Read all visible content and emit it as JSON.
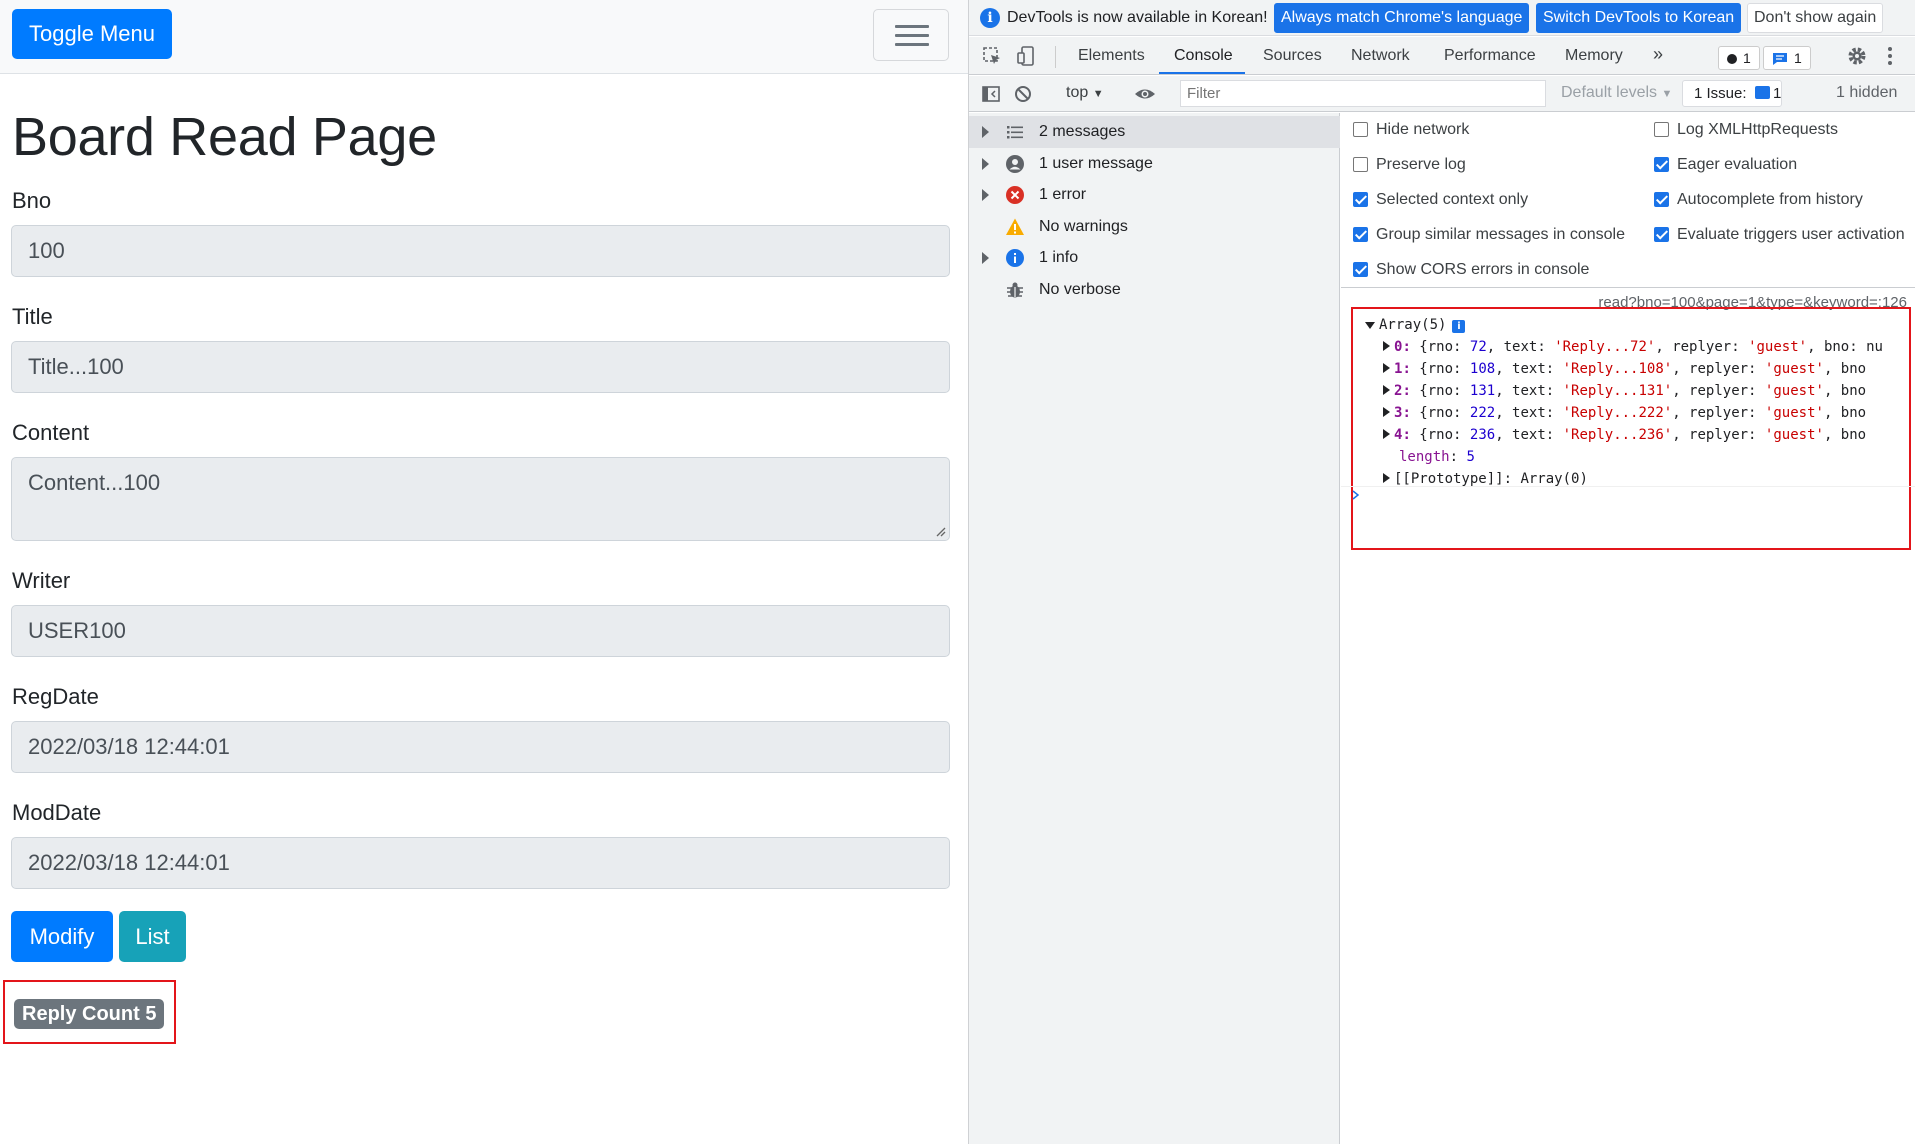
{
  "page": {
    "navbar": {
      "toggle_label": "Toggle Menu"
    },
    "title": "Board Read Page",
    "fields": {
      "bno": {
        "label": "Bno",
        "value": "100"
      },
      "title": {
        "label": "Title",
        "value": "Title...100"
      },
      "content": {
        "label": "Content",
        "value": "Content...100"
      },
      "writer": {
        "label": "Writer",
        "value": "USER100"
      },
      "regdate": {
        "label": "RegDate",
        "value": "2022/03/18 12:44:01"
      },
      "moddate": {
        "label": "ModDate",
        "value": "2022/03/18 12:44:01"
      }
    },
    "buttons": {
      "modify": "Modify",
      "list": "List"
    },
    "reply_count": "Reply Count 5"
  },
  "devtools": {
    "infobar": {
      "text": "DevTools is now available in Korean!",
      "btn_match": "Always match Chrome's language",
      "btn_switch": "Switch DevTools to Korean",
      "btn_dismiss": "Don't show again"
    },
    "tabs": [
      "Elements",
      "Console",
      "Sources",
      "Network",
      "Performance",
      "Memory"
    ],
    "active_tab": "Console",
    "more_tabs": "»",
    "error_count": "1",
    "message_count": "1",
    "filterbar": {
      "context": "top",
      "filter_placeholder": "Filter",
      "levels": "Default levels",
      "issues_label": "1 Issue:",
      "issues_count": "1",
      "hidden": "1 hidden"
    },
    "sidebar": [
      {
        "label": "2 messages",
        "icon": "list-icon",
        "expandable": true
      },
      {
        "label": "1 user message",
        "icon": "user-icon",
        "expandable": true
      },
      {
        "label": "1 error",
        "icon": "error-icon",
        "expandable": true
      },
      {
        "label": "No warnings",
        "icon": "warning-icon",
        "expandable": false
      },
      {
        "label": "1 info",
        "icon": "info-icon",
        "expandable": true
      },
      {
        "label": "No verbose",
        "icon": "bug-icon",
        "expandable": false
      }
    ],
    "settings": {
      "hide_network": {
        "label": "Hide network",
        "checked": false
      },
      "preserve_log": {
        "label": "Preserve log",
        "checked": false
      },
      "selected_context": {
        "label": "Selected context only",
        "checked": true
      },
      "group_similar": {
        "label": "Group similar messages in console",
        "checked": true
      },
      "cors_errors": {
        "label": "Show CORS errors in console",
        "checked": true
      },
      "log_xhr": {
        "label": "Log XMLHttpRequests",
        "checked": false
      },
      "eager_eval": {
        "label": "Eager evaluation",
        "checked": true
      },
      "autocomplete": {
        "label": "Autocomplete from history",
        "checked": true
      },
      "triggers_activation": {
        "label": "Evaluate triggers user activation",
        "checked": true
      }
    },
    "console": {
      "source_link": "read?bno=100&page=1&type=&keyword=:126",
      "array_header": "Array(5)",
      "items": [
        {
          "idx": "0",
          "rno": "72",
          "text": "'Reply...72'",
          "replyer": "'guest'",
          "tail": "bno: nu"
        },
        {
          "idx": "1",
          "rno": "108",
          "text": "'Reply...108'",
          "replyer": "'guest'",
          "tail": "bno"
        },
        {
          "idx": "2",
          "rno": "131",
          "text": "'Reply...131'",
          "replyer": "'guest'",
          "tail": "bno"
        },
        {
          "idx": "3",
          "rno": "222",
          "text": "'Reply...222'",
          "replyer": "'guest'",
          "tail": "bno"
        },
        {
          "idx": "4",
          "rno": "236",
          "text": "'Reply...236'",
          "replyer": "'guest'",
          "tail": "bno"
        }
      ],
      "length_key": "length",
      "length_value": "5",
      "prototype_key": "[[Prototype]]",
      "prototype_value": "Array(0)"
    }
  },
  "colors": {
    "primary": "#007bff",
    "info": "#17a2b8",
    "secondary": "#6c757d",
    "highlight_frame": "#e3151a",
    "devtools_blue": "#1a73e8"
  }
}
